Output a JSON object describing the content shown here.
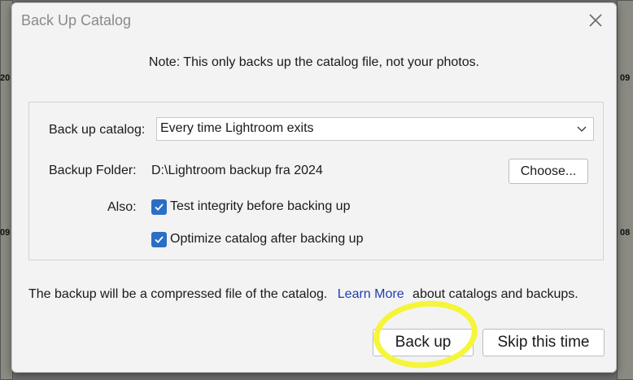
{
  "dialog": {
    "title": "Back Up Catalog",
    "note": "Note: This only backs up the catalog file, not your photos."
  },
  "options": {
    "backup_catalog_label": "Back up catalog:",
    "backup_catalog_value": "Every time Lightroom exits",
    "backup_folder_label": "Backup Folder:",
    "backup_folder_value": "D:\\Lightroom backup fra 2024",
    "choose_label": "Choose...",
    "also_label": "Also:",
    "checkboxes": [
      {
        "label": "Test integrity before backing up",
        "checked": true
      },
      {
        "label": "Optimize catalog after backing up",
        "checked": true
      }
    ]
  },
  "footer": {
    "info_text": "The backup will be a compressed file of the catalog.",
    "learn_more": "Learn More",
    "info_suffix": "about catalogs and backups."
  },
  "buttons": {
    "back_up": "Back up",
    "skip": "Skip this time"
  },
  "background": {
    "labels": [
      "20",
      "09",
      "09",
      "08"
    ]
  },
  "colors": {
    "accent": "#2a6ec6",
    "highlight": "#f5f53a",
    "link": "#1f3fae"
  }
}
